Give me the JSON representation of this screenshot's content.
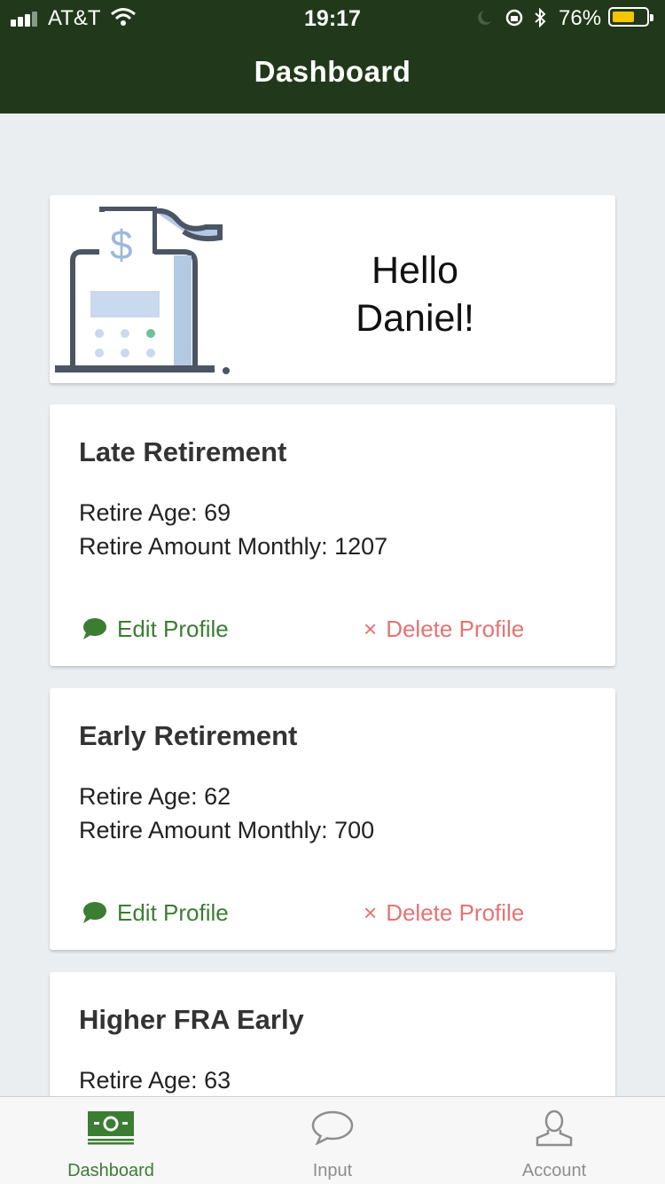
{
  "status_bar": {
    "carrier": "AT&T",
    "time": "19:17",
    "battery": "76%",
    "battery_level": 0.76
  },
  "nav": {
    "title": "Dashboard"
  },
  "greeting": {
    "line1": "Hello",
    "line2": "Daniel!",
    "icon": "cash-register-icon"
  },
  "profiles": [
    {
      "name": "Late Retirement",
      "age": "Retire Age: 69",
      "amount": "Retire Amount Monthly: 1207",
      "edit_label": "Edit Profile",
      "delete_label": "Delete Profile"
    },
    {
      "name": "Early Retirement",
      "age": "Retire Age: 62",
      "amount": "Retire Amount Monthly: 700",
      "edit_label": "Edit Profile",
      "delete_label": "Delete Profile"
    },
    {
      "name": "Higher FRA Early",
      "age": "Retire Age: 63"
    }
  ],
  "tabs": [
    {
      "label": "Dashboard",
      "icon": "money-icon",
      "active": true
    },
    {
      "label": "Input",
      "icon": "speech-bubble-icon",
      "active": false
    },
    {
      "label": "Account",
      "icon": "user-icon",
      "active": false
    }
  ],
  "colors": {
    "header": "#21391a",
    "accent": "#3b7d33",
    "danger": "#e57373",
    "background": "#ebeef1",
    "inactive_tab": "#8e8e8e"
  }
}
